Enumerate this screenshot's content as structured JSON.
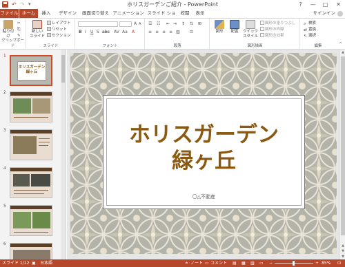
{
  "window": {
    "title": "ホリスガーデンご紹介 - PowerPoint",
    "minimize": "—",
    "maximize": "□",
    "close": "✕",
    "help": "?"
  },
  "quick_access": {
    "undo": "↶",
    "redo": "↷",
    "customize": "▾"
  },
  "tabs": [
    "ファイル",
    "ホーム",
    "挿入",
    "デザイン",
    "画面切り替え",
    "アニメーション",
    "スライド ショー",
    "校閲",
    "表示"
  ],
  "active_tab": "ホーム",
  "account": {
    "signin": "サインイン"
  },
  "ribbon": {
    "clipboard": {
      "label": "クリップボード",
      "paste": "貼り付け"
    },
    "slides": {
      "label": "スライド",
      "new_slide": "新しい",
      "new_slide2": "スライド",
      "layout": "レイアウト",
      "reset": "リセット",
      "section": "セクション"
    },
    "font": {
      "label": "フォント"
    },
    "paragraph": {
      "label": "段落"
    },
    "drawing": {
      "label": "図形描画",
      "shapes": "図形",
      "arrange": "配置",
      "quick_styles": "クイック",
      "quick_styles2": "スタイル",
      "fill": "図形の塗りつぶし",
      "outline": "図形の枠線",
      "effects": "図形の効果"
    },
    "editing": {
      "label": "編集",
      "find": "検索",
      "replace": "置換",
      "select": "選択"
    }
  },
  "slides_pane": {
    "numbers": [
      "1",
      "2",
      "3",
      "4",
      "5",
      "6"
    ],
    "slide1_title": "ホリスガーデン緑ヶ丘"
  },
  "slide": {
    "title_line1": "ホリスガーデン",
    "title_line2": "緑ヶ丘",
    "subtitle": "〇△不動産"
  },
  "status": {
    "slide_pos": "スライド 1/12",
    "language": "日本語",
    "notes": "ノート",
    "comments": "コメント",
    "zoom": "85%"
  },
  "colors": {
    "accent": "#b7472a",
    "title_text": "#8b5a10",
    "slide_bg": "#b3b3a9"
  }
}
